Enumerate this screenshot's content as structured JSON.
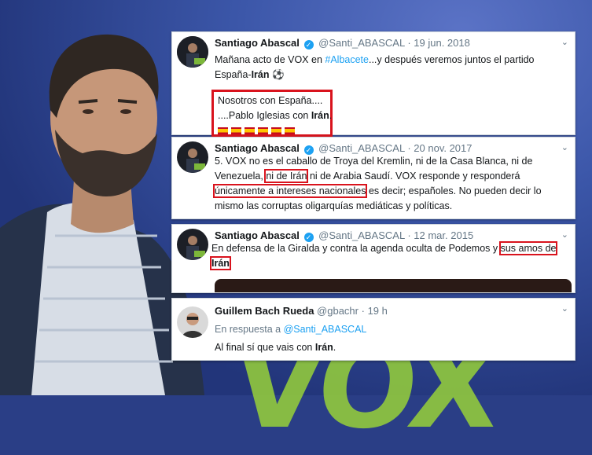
{
  "colors": {
    "highlight": "#d9131d",
    "link": "#1da1f2",
    "vox_green": "#8fc63f"
  },
  "background": {
    "vox_text": "VOX"
  },
  "tweets": [
    {
      "name": "Santiago Abascal",
      "handle": "@Santi_ABASCAL",
      "date": "19 jun. 2018",
      "line1_a": "Mañana acto de VOX en ",
      "line1_link": "#Albacete",
      "line1_b": "...y después veremos juntos el partido",
      "line2_a": "España-",
      "line2_b": "Irán",
      "quote1": "Nosotros con España....",
      "quote2_a": "....Pablo Iglesias con ",
      "quote2_b": "Irán",
      "quote2_c": "."
    },
    {
      "name": "Santiago Abascal",
      "handle": "@Santi_ABASCAL",
      "date": "20 nov. 2017",
      "l1": "5. VOX no es el caballo de Troya del Kremlin, ni de la Casa Blanca,  ni de",
      "l2_a": "Venezuela, ",
      "l2_hl": "ni de Irán",
      "l2_b": " ni de Arabia Saudí.  VOX responde y responderá",
      "l3_hl": "únicamente a intereses nacionales",
      "l3_b": " es decir; españoles. No pueden decir lo",
      "l4": "mismo las corruptas oligarquías mediáticas y políticas."
    },
    {
      "name": "Santiago Abascal",
      "handle": "@Santi_ABASCAL",
      "date": "12 mar. 2015",
      "l1_a": "En defensa de la Giralda y contra la agenda oculta de Podemos y ",
      "l1_hl": "sus amos de",
      "l2_hl": "Irán"
    },
    {
      "name": "Guillem Bach Rueda",
      "handle": "@gbachr",
      "date": "19 h",
      "reply_a": "En respuesta a ",
      "reply_link": "@Santi_ABASCAL",
      "text_a": "Al final sí que vais con ",
      "text_b": "Irán",
      "text_c": "."
    }
  ]
}
